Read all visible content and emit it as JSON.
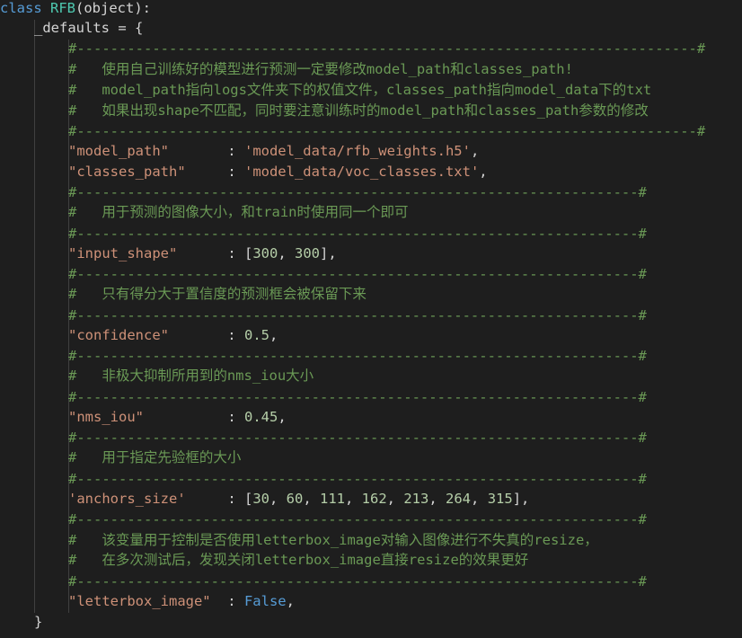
{
  "code": {
    "class_kw": "class",
    "class_name": "RFB",
    "class_base": "(object):",
    "defaults_name": "_defaults = {",
    "sep_long": "#--------------------------------------------------------------------------#",
    "sep_short": "#-------------------------------------------------------------------#",
    "comment1": "#   使用自己训练好的模型进行预测一定要修改model_path和classes_path!",
    "comment2": "#   model_path指向logs文件夹下的权值文件，classes_path指向model_data下的txt",
    "comment3": "#   如果出现shape不匹配，同时要注意训练时的model_path和classes_path参数的修改",
    "model_path_key": "\"model_path\"",
    "model_path_colon": "       : ",
    "model_path_val": "'model_data/rfb_weights.h5'",
    "model_path_comma": ",",
    "classes_path_key": "\"classes_path\"",
    "classes_path_colon": "     : ",
    "classes_path_val": "'model_data/voc_classes.txt'",
    "classes_path_comma": ",",
    "comment4": "#   用于预测的图像大小，和train时使用同一个即可",
    "input_shape_key": "\"input_shape\"",
    "input_shape_colon": "      : [",
    "input_shape_v1": "300",
    "input_shape_sep": ", ",
    "input_shape_v2": "300",
    "input_shape_end": "],",
    "comment5": "#   只有得分大于置信度的预测框会被保留下来",
    "confidence_key": "\"confidence\"",
    "confidence_colon": "       : ",
    "confidence_val": "0.5",
    "confidence_comma": ",",
    "comment6": "#   非极大抑制所用到的nms_iou大小",
    "nms_key": "\"nms_iou\"",
    "nms_colon": "          : ",
    "nms_val": "0.45",
    "nms_comma": ",",
    "comment7": "#   用于指定先验框的大小",
    "anchors_key": "'anchors_size'",
    "anchors_colon": "     : [",
    "anchors_values": [
      "30",
      "60",
      "111",
      "162",
      "213",
      "264",
      "315"
    ],
    "anchors_end": "],",
    "comment8": "#   该变量用于控制是否使用letterbox_image对输入图像进行不失真的resize，",
    "comment9": "#   在多次测试后，发现关闭letterbox_image直接resize的效果更好",
    "letterbox_key": "\"letterbox_image\"",
    "letterbox_colon": "  : ",
    "letterbox_val": "False",
    "letterbox_comma": ",",
    "close_brace": "}"
  }
}
